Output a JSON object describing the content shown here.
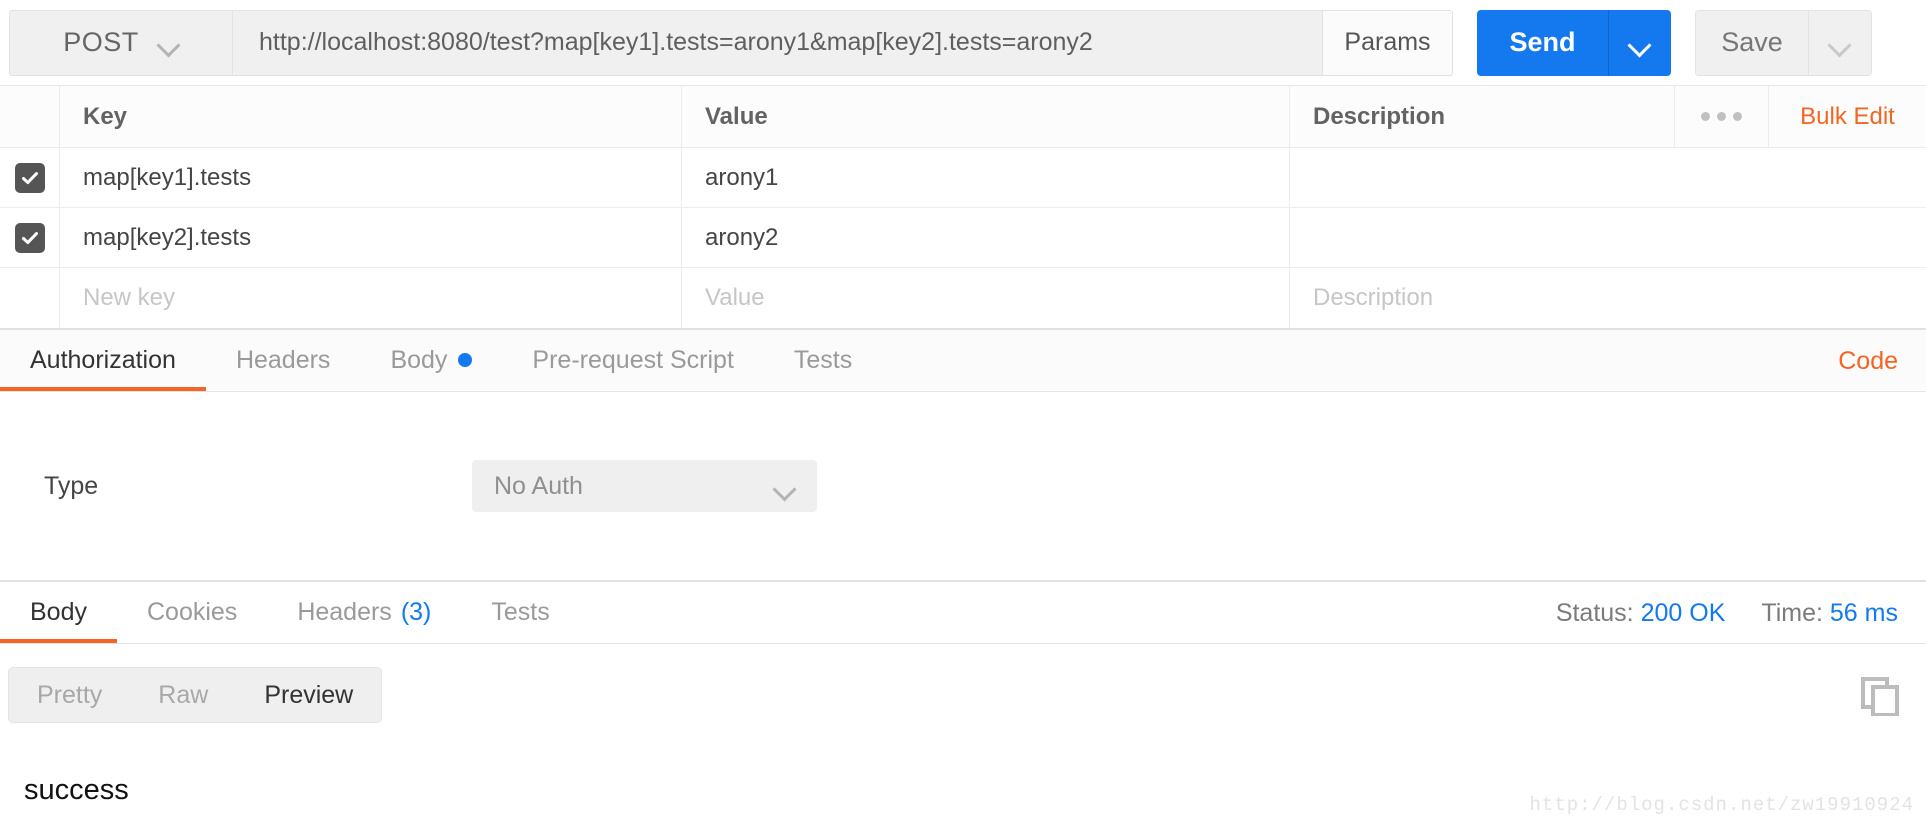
{
  "request_bar": {
    "method": "POST",
    "url": "http://localhost:8080/test?map[key1].tests=arony1&map[key2].tests=arony2",
    "params_button": "Params",
    "send_button": "Send",
    "save_button": "Save"
  },
  "params_table": {
    "headers": {
      "key": "Key",
      "value": "Value",
      "description": "Description",
      "bulk_edit": "Bulk Edit"
    },
    "rows": [
      {
        "checked": true,
        "key": "map[key1].tests",
        "value": "arony1",
        "description": ""
      },
      {
        "checked": true,
        "key": "map[key2].tests",
        "value": "arony2",
        "description": ""
      }
    ],
    "placeholder_row": {
      "key": "New key",
      "value": "Value",
      "description": "Description"
    }
  },
  "request_tabs": {
    "items": [
      {
        "label": "Authorization",
        "active": true,
        "dot": false
      },
      {
        "label": "Headers",
        "active": false,
        "dot": false
      },
      {
        "label": "Body",
        "active": false,
        "dot": true
      },
      {
        "label": "Pre-request Script",
        "active": false,
        "dot": false
      },
      {
        "label": "Tests",
        "active": false,
        "dot": false
      }
    ],
    "code_link": "Code"
  },
  "auth_panel": {
    "type_label": "Type",
    "type_value": "No Auth"
  },
  "response_tabs": {
    "items": [
      {
        "label": "Body",
        "count": "",
        "active": true
      },
      {
        "label": "Cookies",
        "count": "",
        "active": false
      },
      {
        "label": "Headers",
        "count": "(3)",
        "active": false
      },
      {
        "label": "Tests",
        "count": "",
        "active": false
      }
    ],
    "status_label": "Status:",
    "status_value": "200 OK",
    "time_label": "Time:",
    "time_value": "56 ms"
  },
  "body_viewer": {
    "modes": [
      {
        "label": "Pretty",
        "active": false
      },
      {
        "label": "Raw",
        "active": false
      },
      {
        "label": "Preview",
        "active": true
      }
    ],
    "content": "success"
  },
  "watermark": "http://blog.csdn.net/zw19910924",
  "colors": {
    "accent_orange": "#f26522",
    "accent_blue": "#1479ef",
    "checkbox": "#555555"
  }
}
